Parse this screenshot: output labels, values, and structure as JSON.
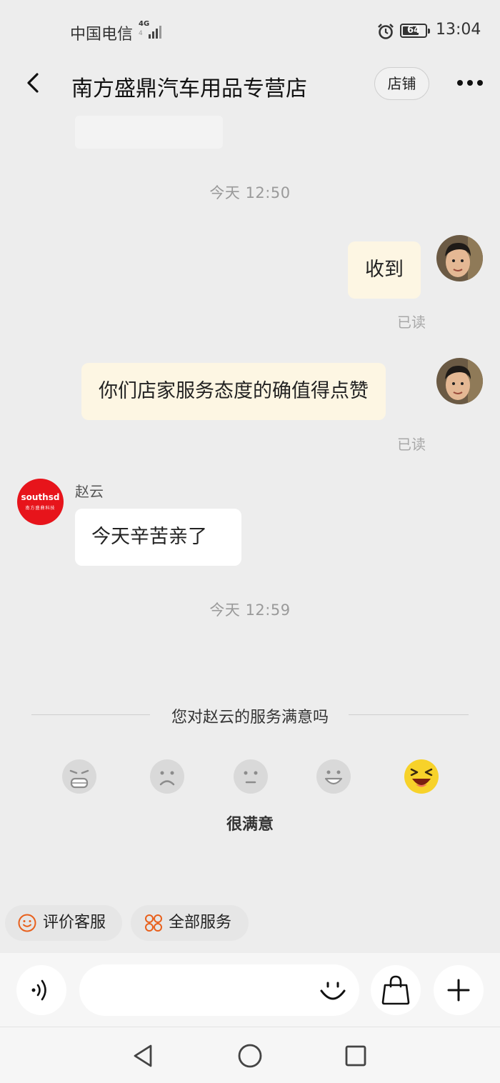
{
  "status_bar": {
    "carrier": "中国电信",
    "network": "4G",
    "network_sub": "4",
    "battery": "64",
    "battery_level": 0.64,
    "time": "13:04"
  },
  "header": {
    "title": "南方盛鼎汽车用品专营店",
    "shop_button": "店铺"
  },
  "chat": {
    "time_1": "今天  12:50",
    "msg_1": "收到",
    "read_1": "已读",
    "msg_2": "你们店家服务态度的确值得点赞",
    "read_2": "已读",
    "agent_name": "赵云",
    "shop_avatar_text": "southsd",
    "shop_avatar_subtext": "南方盛鼎科技",
    "msg_3": "今天辛苦亲了",
    "time_2": "今天  12:59"
  },
  "survey": {
    "question": "您对赵云的服务满意吗",
    "selected_label": "很满意",
    "options": [
      "very-dissatisfied",
      "dissatisfied",
      "neutral",
      "satisfied",
      "very-satisfied"
    ],
    "selected_index": 4
  },
  "quick_actions": {
    "rate": "评价客服",
    "all_services": "全部服务"
  },
  "colors": {
    "accent": "#e8601c",
    "bubble_me": "#fdf6e3",
    "shop_red": "#e7141b",
    "emoji_yellow": "#f7d22a"
  }
}
